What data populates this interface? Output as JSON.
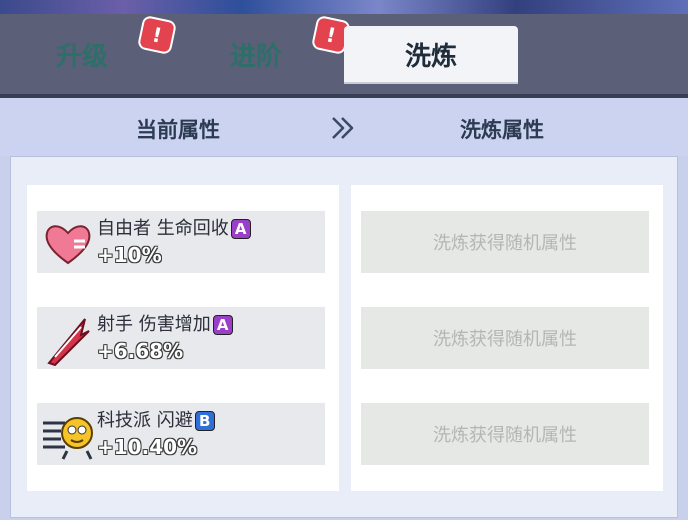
{
  "tabs": [
    {
      "label": "升级",
      "badge": "!"
    },
    {
      "label": "进阶",
      "badge": "!"
    },
    {
      "label": "洗炼"
    }
  ],
  "header": {
    "current_title": "当前属性",
    "reroll_title": "洗炼属性"
  },
  "attributes": [
    {
      "name": "自由者 生命回收",
      "grade": "A",
      "value": "+10%",
      "icon": "heart-icon"
    },
    {
      "name": "射手 伤害增加",
      "grade": "A",
      "value": "+6.68%",
      "icon": "slash-icon"
    },
    {
      "name": "科技派 闪避",
      "grade": "B",
      "value": "+10.40%",
      "icon": "robot-emoji-icon"
    }
  ],
  "reroll_slots": [
    {
      "text": "洗炼获得随机属性"
    },
    {
      "text": "洗炼获得随机属性"
    },
    {
      "text": "洗炼获得随机属性"
    }
  ],
  "colors": {
    "grade_A": "#9b3fc8",
    "grade_B": "#2f6fd8",
    "tab_bg": "#5b5f78",
    "active_tab": "#f3f4f8"
  }
}
